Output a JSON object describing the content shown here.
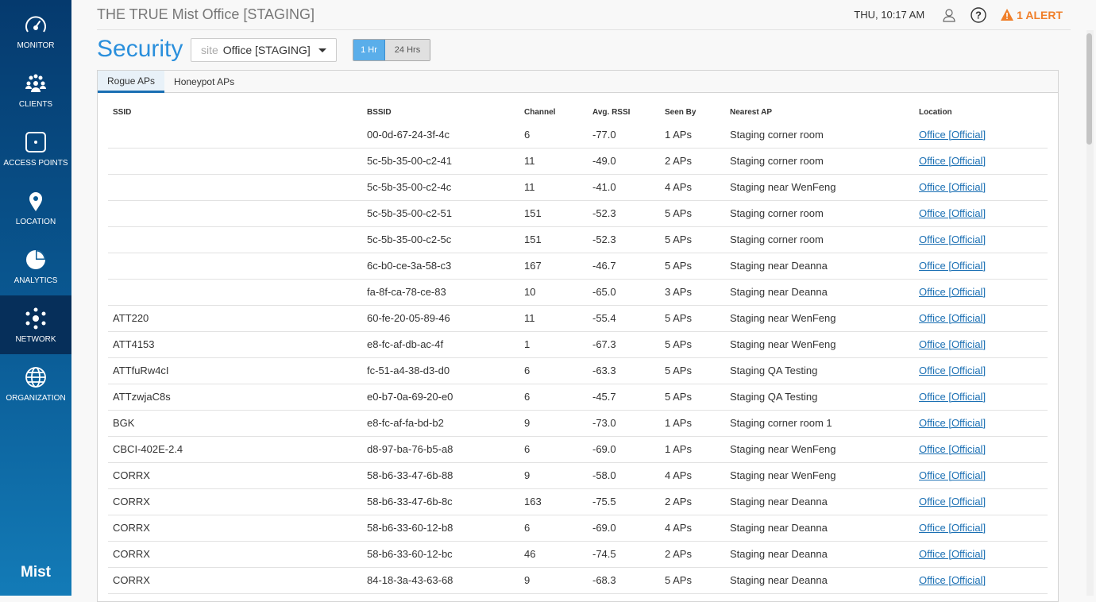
{
  "sidebar": {
    "items": [
      {
        "label": "MONITOR",
        "icon": "gauge-icon"
      },
      {
        "label": "CLIENTS",
        "icon": "clients-icon"
      },
      {
        "label": "ACCESS POINTS",
        "icon": "access-point-icon"
      },
      {
        "label": "LOCATION",
        "icon": "location-pin-icon"
      },
      {
        "label": "ANALYTICS",
        "icon": "pie-chart-icon"
      },
      {
        "label": "NETWORK",
        "icon": "network-icon",
        "active": true
      },
      {
        "label": "ORGANIZATION",
        "icon": "globe-icon"
      }
    ],
    "logo": "Mist"
  },
  "header": {
    "org": "THE TRUE Mist Office [STAGING]",
    "time": "THU, 10:17 AM",
    "alert": "1 ALERT",
    "alert_color": "#f07f2a"
  },
  "page": {
    "title": "Security",
    "site_label": "site",
    "site_value": "Office [STAGING]",
    "range": [
      "1 Hr",
      "24 Hrs"
    ]
  },
  "tabs": [
    "Rogue APs",
    "Honeypot APs"
  ],
  "table": {
    "columns": [
      "SSID",
      "BSSID",
      "Channel",
      "Avg. RSSI",
      "Seen By",
      "Nearest AP",
      "Location"
    ],
    "rows": [
      [
        "",
        "00-0d-67-24-3f-4c",
        "6",
        "-77.0",
        "1 APs",
        "Staging corner room",
        "Office [Official]"
      ],
      [
        "",
        "5c-5b-35-00-c2-41",
        "11",
        "-49.0",
        "2 APs",
        "Staging corner room",
        "Office [Official]"
      ],
      [
        "",
        "5c-5b-35-00-c2-4c",
        "11",
        "-41.0",
        "4 APs",
        "Staging near WenFeng",
        "Office [Official]"
      ],
      [
        "",
        "5c-5b-35-00-c2-51",
        "151",
        "-52.3",
        "5 APs",
        "Staging corner room",
        "Office [Official]"
      ],
      [
        "",
        "5c-5b-35-00-c2-5c",
        "151",
        "-52.3",
        "5 APs",
        "Staging corner room",
        "Office [Official]"
      ],
      [
        "",
        "6c-b0-ce-3a-58-c3",
        "167",
        "-46.7",
        "5 APs",
        "Staging near Deanna",
        "Office [Official]"
      ],
      [
        "",
        "fa-8f-ca-78-ce-83",
        "10",
        "-65.0",
        "3 APs",
        "Staging near Deanna",
        "Office [Official]"
      ],
      [
        "ATT220",
        "60-fe-20-05-89-46",
        "11",
        "-55.4",
        "5 APs",
        "Staging near WenFeng",
        "Office [Official]"
      ],
      [
        "ATT4153",
        "e8-fc-af-db-ac-4f",
        "1",
        "-67.3",
        "5 APs",
        "Staging near WenFeng",
        "Office [Official]"
      ],
      [
        "ATTfuRw4cI",
        "fc-51-a4-38-d3-d0",
        "6",
        "-63.3",
        "5 APs",
        "Staging QA Testing",
        "Office [Official]"
      ],
      [
        "ATTzwjaC8s",
        "e0-b7-0a-69-20-e0",
        "6",
        "-45.7",
        "5 APs",
        "Staging QA Testing",
        "Office [Official]"
      ],
      [
        "BGK",
        "e8-fc-af-fa-bd-b2",
        "9",
        "-73.0",
        "1 APs",
        "Staging corner room 1",
        "Office [Official]"
      ],
      [
        "CBCI-402E-2.4",
        "d8-97-ba-76-b5-a8",
        "6",
        "-69.0",
        "1 APs",
        "Staging near WenFeng",
        "Office [Official]"
      ],
      [
        "CORRX",
        "58-b6-33-47-6b-88",
        "9",
        "-58.0",
        "4 APs",
        "Staging near WenFeng",
        "Office [Official]"
      ],
      [
        "CORRX",
        "58-b6-33-47-6b-8c",
        "163",
        "-75.5",
        "2 APs",
        "Staging near Deanna",
        "Office [Official]"
      ],
      [
        "CORRX",
        "58-b6-33-60-12-b8",
        "6",
        "-69.0",
        "4 APs",
        "Staging near Deanna",
        "Office [Official]"
      ],
      [
        "CORRX",
        "58-b6-33-60-12-bc",
        "46",
        "-74.5",
        "2 APs",
        "Staging near Deanna",
        "Office [Official]"
      ],
      [
        "CORRX",
        "84-18-3a-43-63-68",
        "9",
        "-68.3",
        "5 APs",
        "Staging near Deanna",
        "Office [Official]"
      ]
    ]
  }
}
